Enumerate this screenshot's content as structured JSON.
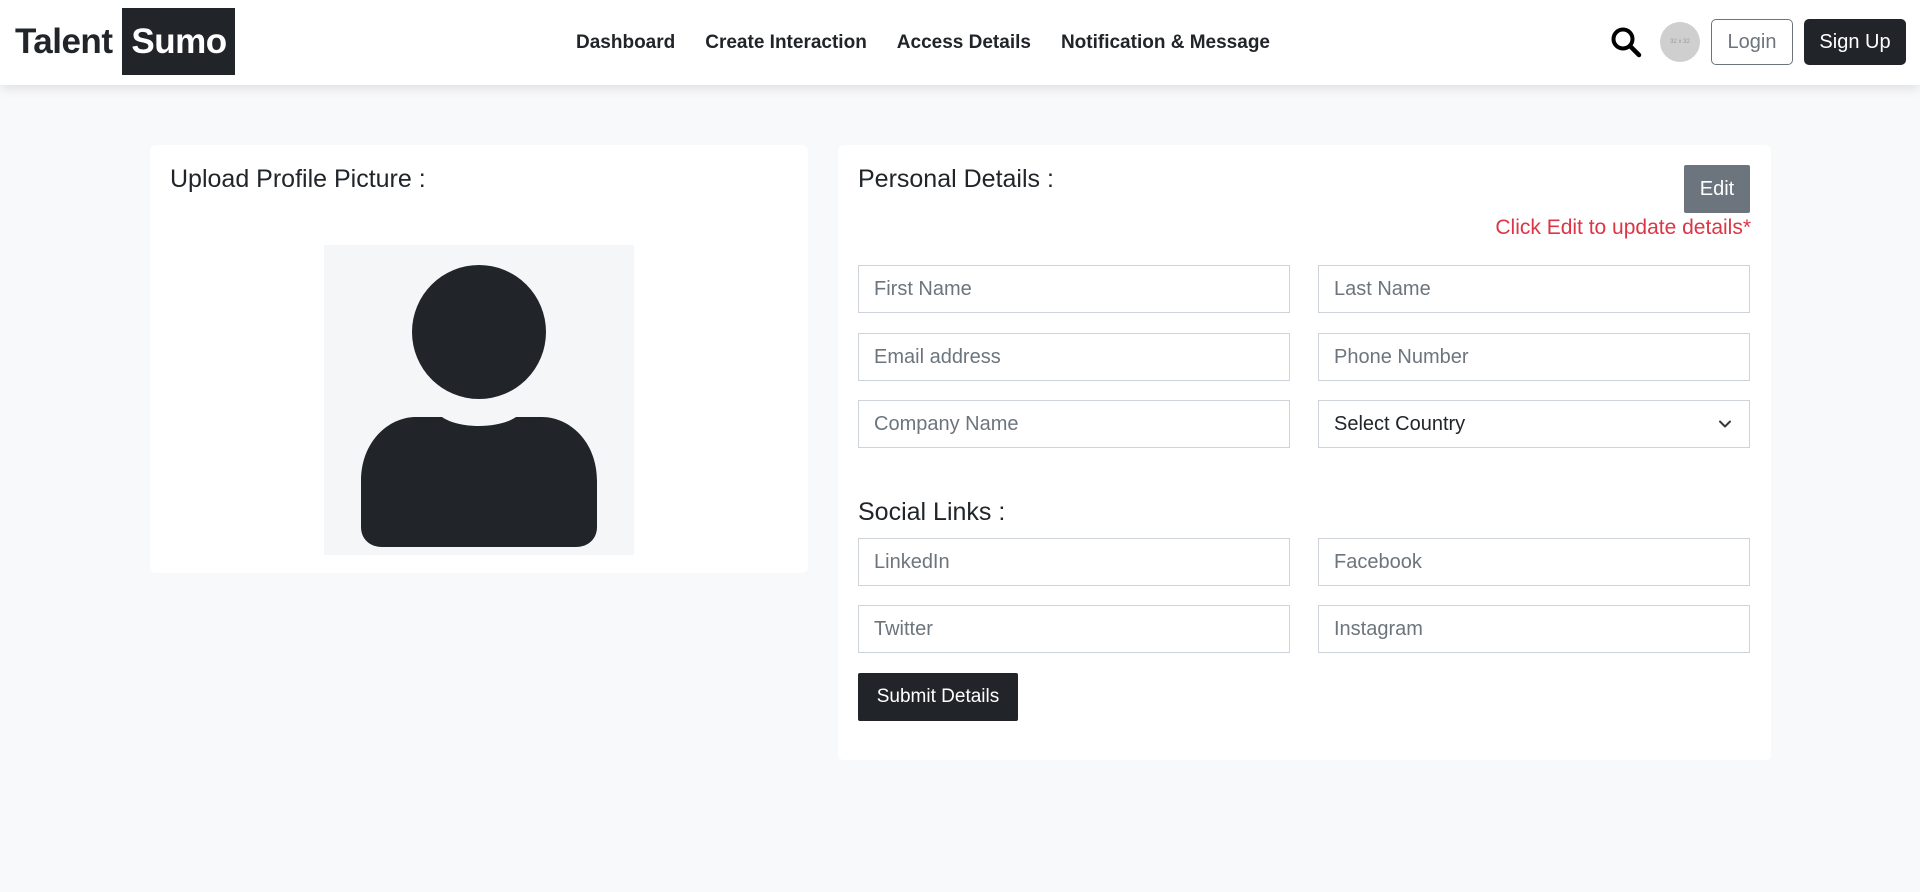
{
  "brand": {
    "part1": "Talent",
    "part2": "Sumo"
  },
  "nav": {
    "links": [
      "Dashboard",
      "Create Interaction",
      "Access Details",
      "Notification & Message"
    ],
    "avatar_text": "32 x 32",
    "login_label": "Login",
    "signup_label": "Sign Up"
  },
  "upload": {
    "title": "Upload Profile Picture :"
  },
  "personal": {
    "title": "Personal Details :",
    "edit_label": "Edit",
    "edit_note": "Click Edit to update details*",
    "first_name_placeholder": "First Name",
    "last_name_placeholder": "Last Name",
    "email_placeholder": "Email address",
    "phone_placeholder": "Phone Number",
    "company_placeholder": "Company Name",
    "country_selected": "Select Country"
  },
  "social": {
    "title": "Social Links :",
    "linkedin_placeholder": "LinkedIn",
    "facebook_placeholder": "Facebook",
    "twitter_placeholder": "Twitter",
    "instagram_placeholder": "Instagram",
    "submit_label": "Submit Details"
  },
  "colors": {
    "dark": "#212529",
    "secondary": "#6c757d",
    "danger": "#dc3545",
    "background": "#f8f9fa"
  },
  "icons": [
    "search-icon",
    "user-silhouette-icon",
    "chevron-down-icon"
  ]
}
